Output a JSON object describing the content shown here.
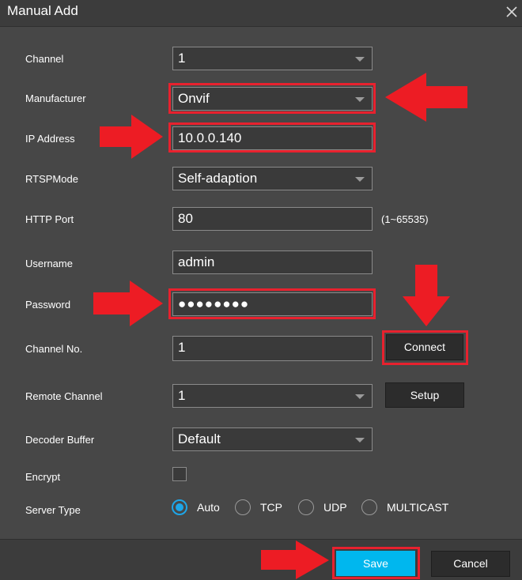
{
  "dialog": {
    "title": "Manual Add",
    "close_icon": "close-icon"
  },
  "form": {
    "channel": {
      "label": "Channel",
      "value": "1"
    },
    "manufacturer": {
      "label": "Manufacturer",
      "value": "Onvif"
    },
    "ip_address": {
      "label": "IP Address",
      "value": "10.0.0.140"
    },
    "rtsp_mode": {
      "label": "RTSPMode",
      "value": "Self-adaption"
    },
    "http_port": {
      "label": "HTTP Port",
      "value": "80",
      "hint": "(1~65535)"
    },
    "username": {
      "label": "Username",
      "value": "admin"
    },
    "password": {
      "label": "Password",
      "value": "●●●●●●●●"
    },
    "channel_no": {
      "label": "Channel No.",
      "value": "1",
      "button": "Connect"
    },
    "remote_channel": {
      "label": "Remote Channel",
      "value": "1",
      "button": "Setup"
    },
    "decoder_buffer": {
      "label": "Decoder Buffer",
      "value": "Default"
    },
    "encrypt": {
      "label": "Encrypt",
      "checked": false
    },
    "server_type": {
      "label": "Server Type",
      "options": [
        "Auto",
        "TCP",
        "UDP",
        "MULTICAST"
      ],
      "selected": "Auto"
    }
  },
  "footer": {
    "save_label": "Save",
    "cancel_label": "Cancel"
  },
  "colors": {
    "background": "#474747",
    "highlight": "#e8212e",
    "primary": "#00b7ee",
    "radio_accent": "#1ea6e8"
  }
}
